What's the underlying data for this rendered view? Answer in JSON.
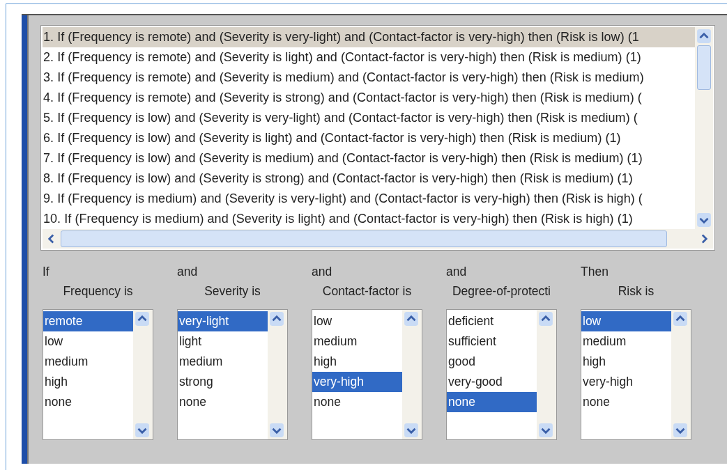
{
  "rules": [
    {
      "text": "1. If (Frequency is remote) and (Severity is very-light) and (Contact-factor is very-high) then (Risk is low) (1",
      "selected": true
    },
    {
      "text": "2. If (Frequency is remote) and (Severity is light) and (Contact-factor is very-high) then (Risk is medium) (1)",
      "selected": false
    },
    {
      "text": "3. If (Frequency is remote) and (Severity is medium) and (Contact-factor is very-high) then (Risk is medium)",
      "selected": false
    },
    {
      "text": "4. If (Frequency is remote) and (Severity is strong) and (Contact-factor is very-high) then (Risk is medium) (",
      "selected": false
    },
    {
      "text": "5. If (Frequency is low) and (Severity is very-light) and (Contact-factor is very-high) then (Risk is medium) (",
      "selected": false
    },
    {
      "text": "6. If (Frequency is low) and (Severity is light) and (Contact-factor is very-high) then (Risk is medium) (1)",
      "selected": false
    },
    {
      "text": "7. If (Frequency is low) and (Severity is medium) and (Contact-factor is very-high) then (Risk is medium) (1)",
      "selected": false
    },
    {
      "text": "8. If (Frequency is low) and (Severity is strong) and (Contact-factor is very-high) then (Risk is medium) (1)",
      "selected": false
    },
    {
      "text": "9. If (Frequency is medium) and (Severity is very-light) and (Contact-factor is very-high) then (Risk is high) (",
      "selected": false
    },
    {
      "text": "10. If (Frequency is medium) and (Severity is light) and (Contact-factor is very-high) then (Risk is high) (1)",
      "selected": false
    }
  ],
  "columns": [
    {
      "connective": "If",
      "variable": "Frequency is",
      "options": [
        {
          "label": "remote",
          "selected": true
        },
        {
          "label": "low",
          "selected": false
        },
        {
          "label": "medium",
          "selected": false
        },
        {
          "label": "high",
          "selected": false
        },
        {
          "label": "none",
          "selected": false
        }
      ]
    },
    {
      "connective": "and",
      "variable": "Severity is",
      "options": [
        {
          "label": "very-light",
          "selected": true
        },
        {
          "label": "light",
          "selected": false
        },
        {
          "label": "medium",
          "selected": false
        },
        {
          "label": "strong",
          "selected": false
        },
        {
          "label": "none",
          "selected": false
        }
      ]
    },
    {
      "connective": "and",
      "variable": "Contact-factor is",
      "options": [
        {
          "label": "low",
          "selected": false
        },
        {
          "label": "medium",
          "selected": false
        },
        {
          "label": "high",
          "selected": false
        },
        {
          "label": "very-high",
          "selected": true
        },
        {
          "label": "none",
          "selected": false
        }
      ]
    },
    {
      "connective": "and",
      "variable": "Degree-of-protecti",
      "options": [
        {
          "label": "deficient",
          "selected": false
        },
        {
          "label": "sufficient",
          "selected": false
        },
        {
          "label": "good",
          "selected": false
        },
        {
          "label": "very-good",
          "selected": false
        },
        {
          "label": "none",
          "selected": true
        }
      ]
    },
    {
      "connective": "Then",
      "variable": "Risk is",
      "options": [
        {
          "label": "low",
          "selected": true
        },
        {
          "label": "medium",
          "selected": false
        },
        {
          "label": "high",
          "selected": false
        },
        {
          "label": "very-high",
          "selected": false
        },
        {
          "label": "none",
          "selected": false
        }
      ]
    }
  ]
}
